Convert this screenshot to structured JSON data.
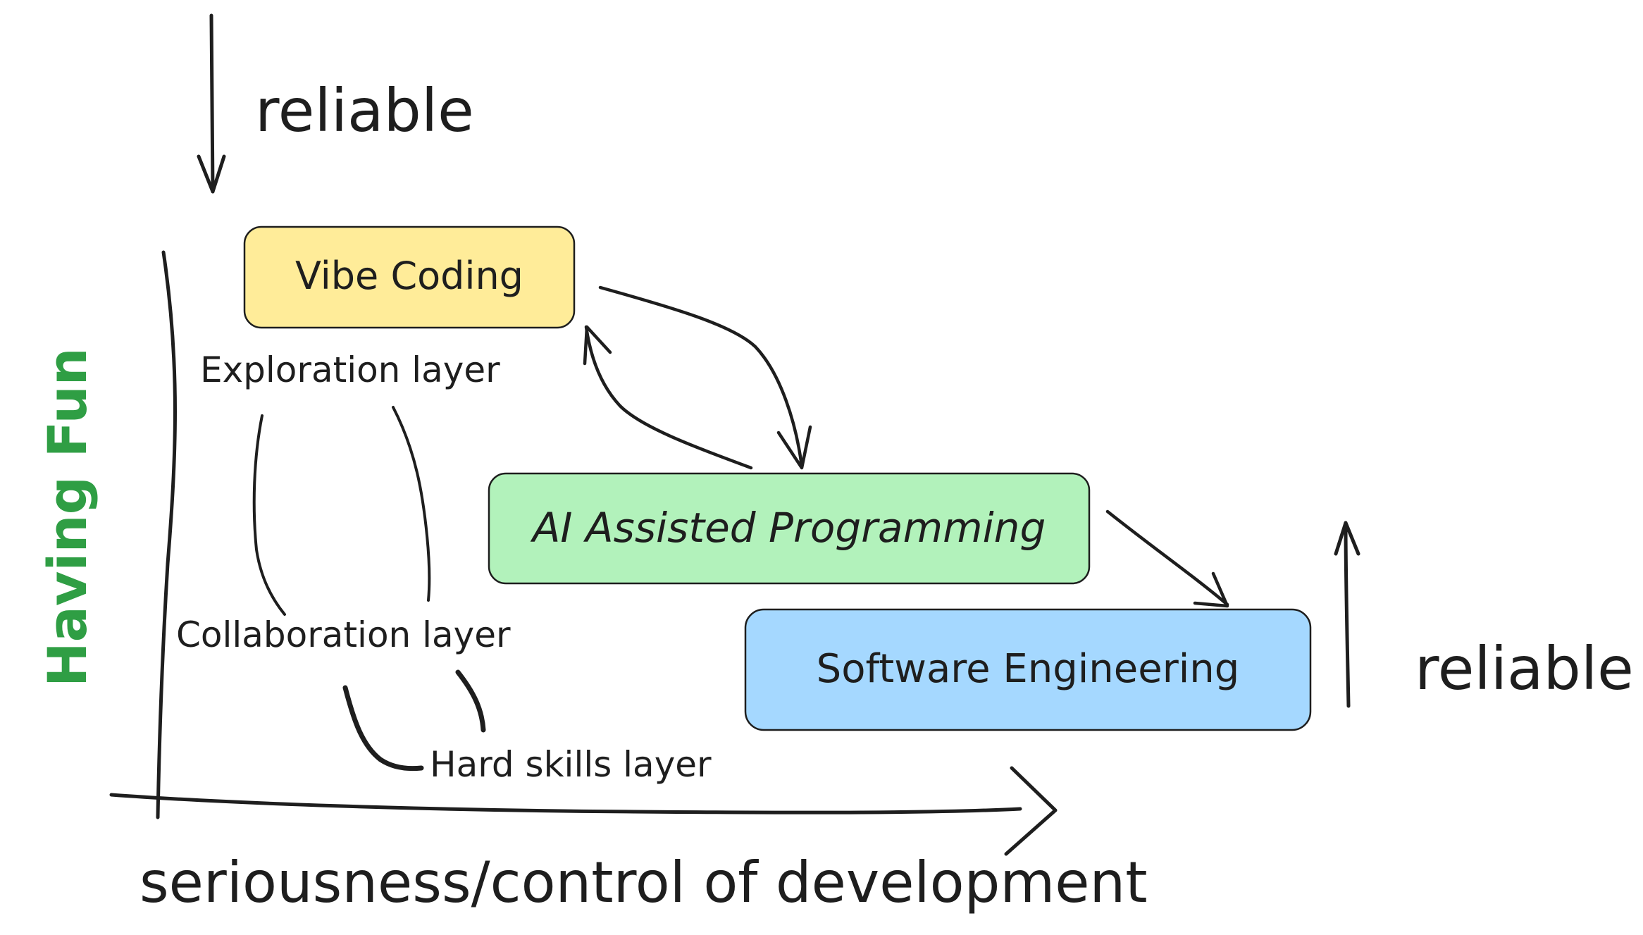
{
  "labels": {
    "reliable_top": "reliable",
    "reliable_right": "reliable",
    "having_fun": "Having Fun",
    "x_axis": "seriousness/control of development",
    "exploration_layer": "Exploration layer",
    "collaboration_layer": "Collaboration layer",
    "hard_skills_layer": "Hard skills layer"
  },
  "boxes": {
    "vibe_coding": "Vibe Coding",
    "ai_assisted": "AI Assisted Programming",
    "software_engineering": "Software Engineering"
  },
  "colors": {
    "ink": "#1e1e1e",
    "having_fun": "#2f9e44",
    "vibe_coding_fill": "#ffec99",
    "ai_assisted_fill": "#b2f2bb",
    "software_engineering_fill": "#a5d8ff"
  }
}
